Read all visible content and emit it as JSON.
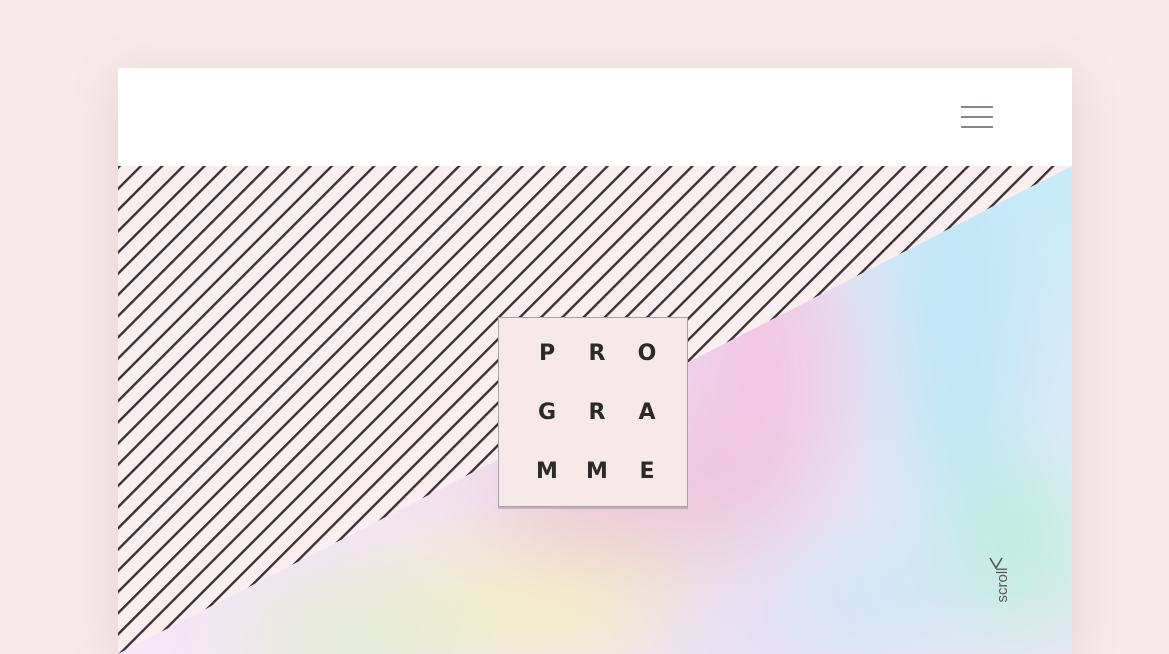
{
  "header": {
    "menu_icon": "hamburger-menu-icon"
  },
  "hero": {
    "logo_letters": [
      [
        "P",
        "R",
        "O"
      ],
      [
        "G",
        "R",
        "A"
      ],
      [
        "M",
        "M",
        "E"
      ]
    ],
    "scroll_label": "scroll",
    "scroll_icon": "chevron-left-icon"
  },
  "colors": {
    "page_background": "#f8e9ea",
    "frame_background": "#ffffff",
    "stripe_color": "#3a3236",
    "logo_box_background": "#f7e8e9",
    "text_dark": "#2b2a2b",
    "holographic_pink": "#f2c7e3",
    "holographic_blue": "#bfe6f7",
    "holographic_yellow": "#f4f0c2",
    "holographic_lilac": "#e6ddf6"
  }
}
